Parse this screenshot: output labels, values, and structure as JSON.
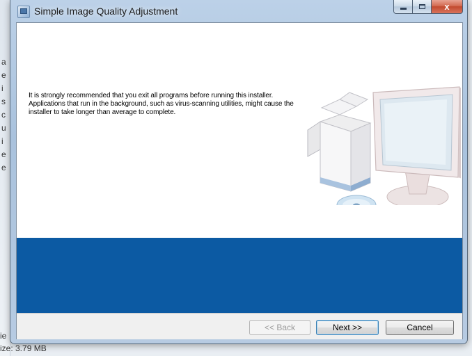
{
  "window": {
    "title": "Simple Image Quality Adjustment",
    "controls": {
      "minimize": "",
      "maximize": "",
      "close": "x"
    }
  },
  "content": {
    "message": "It is strongly recommended that you exit all programs before running this installer. Applications that run in the background, such as virus-scanning utilities, might cause the installer to take longer than average to complete."
  },
  "buttons": {
    "back": "<< Back",
    "next": "Next >>",
    "cancel": "Cancel"
  },
  "background": {
    "letters": [
      "a",
      "e",
      "i",
      "s",
      "c",
      "u",
      "i",
      "e",
      "e"
    ],
    "fragment_ie": "ie",
    "size_text": "ize: 3.79 MB"
  },
  "colors": {
    "band": "#0c5aa3",
    "close_button": "#c24a2f"
  },
  "icons": [
    "installer-app-icon",
    "computer-illustration",
    "cd-disc-icon",
    "box-icon"
  ]
}
